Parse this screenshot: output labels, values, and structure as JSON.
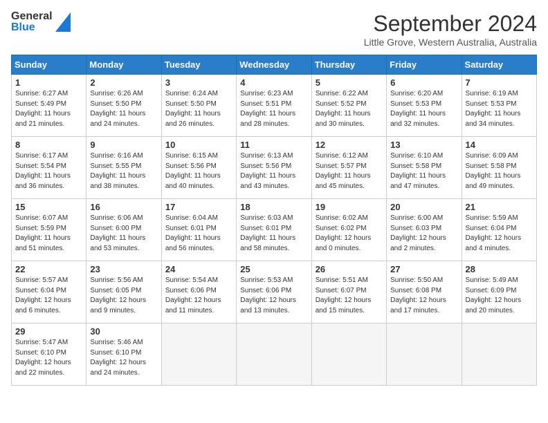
{
  "header": {
    "logo": {
      "general": "General",
      "blue": "Blue"
    },
    "title": "September 2024",
    "location": "Little Grove, Western Australia, Australia"
  },
  "calendar": {
    "headers": [
      "Sunday",
      "Monday",
      "Tuesday",
      "Wednesday",
      "Thursday",
      "Friday",
      "Saturday"
    ],
    "weeks": [
      [
        null,
        {
          "day": "2",
          "sunrise": "6:26 AM",
          "sunset": "5:50 PM",
          "daylight": "11 hours and 24 minutes."
        },
        {
          "day": "3",
          "sunrise": "6:24 AM",
          "sunset": "5:50 PM",
          "daylight": "11 hours and 26 minutes."
        },
        {
          "day": "4",
          "sunrise": "6:23 AM",
          "sunset": "5:51 PM",
          "daylight": "11 hours and 28 minutes."
        },
        {
          "day": "5",
          "sunrise": "6:22 AM",
          "sunset": "5:52 PM",
          "daylight": "11 hours and 30 minutes."
        },
        {
          "day": "6",
          "sunrise": "6:20 AM",
          "sunset": "5:53 PM",
          "daylight": "11 hours and 32 minutes."
        },
        {
          "day": "7",
          "sunrise": "6:19 AM",
          "sunset": "5:53 PM",
          "daylight": "11 hours and 34 minutes."
        }
      ],
      [
        {
          "day": "1",
          "sunrise": "6:27 AM",
          "sunset": "5:49 PM",
          "daylight": "11 hours and 21 minutes."
        },
        null,
        null,
        null,
        null,
        null,
        null
      ],
      [
        {
          "day": "8",
          "sunrise": "6:17 AM",
          "sunset": "5:54 PM",
          "daylight": "11 hours and 36 minutes."
        },
        {
          "day": "9",
          "sunrise": "6:16 AM",
          "sunset": "5:55 PM",
          "daylight": "11 hours and 38 minutes."
        },
        {
          "day": "10",
          "sunrise": "6:15 AM",
          "sunset": "5:56 PM",
          "daylight": "11 hours and 40 minutes."
        },
        {
          "day": "11",
          "sunrise": "6:13 AM",
          "sunset": "5:56 PM",
          "daylight": "11 hours and 43 minutes."
        },
        {
          "day": "12",
          "sunrise": "6:12 AM",
          "sunset": "5:57 PM",
          "daylight": "11 hours and 45 minutes."
        },
        {
          "day": "13",
          "sunrise": "6:10 AM",
          "sunset": "5:58 PM",
          "daylight": "11 hours and 47 minutes."
        },
        {
          "day": "14",
          "sunrise": "6:09 AM",
          "sunset": "5:58 PM",
          "daylight": "11 hours and 49 minutes."
        }
      ],
      [
        {
          "day": "15",
          "sunrise": "6:07 AM",
          "sunset": "5:59 PM",
          "daylight": "11 hours and 51 minutes."
        },
        {
          "day": "16",
          "sunrise": "6:06 AM",
          "sunset": "6:00 PM",
          "daylight": "11 hours and 53 minutes."
        },
        {
          "day": "17",
          "sunrise": "6:04 AM",
          "sunset": "6:01 PM",
          "daylight": "11 hours and 56 minutes."
        },
        {
          "day": "18",
          "sunrise": "6:03 AM",
          "sunset": "6:01 PM",
          "daylight": "11 hours and 58 minutes."
        },
        {
          "day": "19",
          "sunrise": "6:02 AM",
          "sunset": "6:02 PM",
          "daylight": "12 hours and 0 minutes."
        },
        {
          "day": "20",
          "sunrise": "6:00 AM",
          "sunset": "6:03 PM",
          "daylight": "12 hours and 2 minutes."
        },
        {
          "day": "21",
          "sunrise": "5:59 AM",
          "sunset": "6:04 PM",
          "daylight": "12 hours and 4 minutes."
        }
      ],
      [
        {
          "day": "22",
          "sunrise": "5:57 AM",
          "sunset": "6:04 PM",
          "daylight": "12 hours and 6 minutes."
        },
        {
          "day": "23",
          "sunrise": "5:56 AM",
          "sunset": "6:05 PM",
          "daylight": "12 hours and 9 minutes."
        },
        {
          "day": "24",
          "sunrise": "5:54 AM",
          "sunset": "6:06 PM",
          "daylight": "12 hours and 11 minutes."
        },
        {
          "day": "25",
          "sunrise": "5:53 AM",
          "sunset": "6:06 PM",
          "daylight": "12 hours and 13 minutes."
        },
        {
          "day": "26",
          "sunrise": "5:51 AM",
          "sunset": "6:07 PM",
          "daylight": "12 hours and 15 minutes."
        },
        {
          "day": "27",
          "sunrise": "5:50 AM",
          "sunset": "6:08 PM",
          "daylight": "12 hours and 17 minutes."
        },
        {
          "day": "28",
          "sunrise": "5:49 AM",
          "sunset": "6:09 PM",
          "daylight": "12 hours and 20 minutes."
        }
      ],
      [
        {
          "day": "29",
          "sunrise": "5:47 AM",
          "sunset": "6:10 PM",
          "daylight": "12 hours and 22 minutes."
        },
        {
          "day": "30",
          "sunrise": "5:46 AM",
          "sunset": "6:10 PM",
          "daylight": "12 hours and 24 minutes."
        },
        null,
        null,
        null,
        null,
        null
      ]
    ]
  }
}
